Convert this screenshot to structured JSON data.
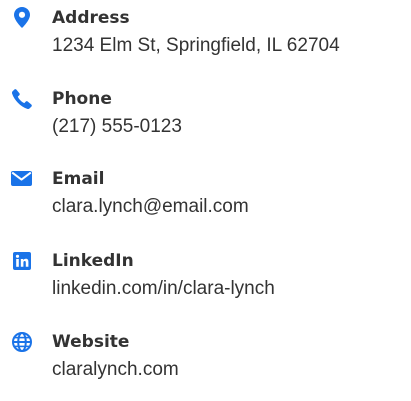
{
  "accent_color": "#1a73e8",
  "contacts": [
    {
      "icon": "location-pin-icon",
      "label": "Address",
      "value": "1234 Elm St, Springfield, IL 62704"
    },
    {
      "icon": "phone-icon",
      "label": "Phone",
      "value": "(217) 555-0123"
    },
    {
      "icon": "envelope-icon",
      "label": "Email",
      "value": "clara.lynch@email.com"
    },
    {
      "icon": "linkedin-icon",
      "label": "LinkedIn",
      "value": "linkedin.com/in/clara-lynch"
    },
    {
      "icon": "globe-icon",
      "label": "Website",
      "value": "claralynch.com"
    }
  ]
}
